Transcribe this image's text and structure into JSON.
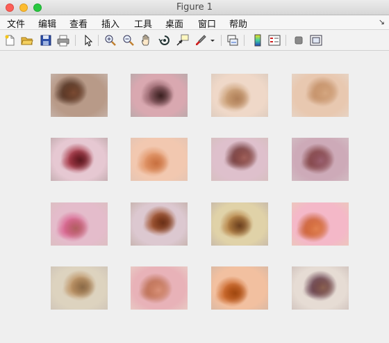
{
  "window": {
    "title": "Figure 1"
  },
  "menu": {
    "items": [
      "文件",
      "编辑",
      "查看",
      "插入",
      "工具",
      "桌面",
      "窗口",
      "帮助"
    ],
    "overflow_icon": "dock-arrow-icon"
  },
  "toolbar": {
    "buttons": [
      "new-figure-icon",
      "open-folder-icon",
      "save-icon",
      "print-icon",
      "pointer-icon",
      "zoom-in-icon",
      "zoom-out-icon",
      "pan-hand-icon",
      "rotate-3d-icon",
      "data-cursor-icon",
      "brush-icon",
      "brush-dropdown-icon",
      "link-plot-icon",
      "colorbar-icon",
      "legend-icon",
      "hide-plot-tools-icon",
      "show-plot-tools-icon"
    ]
  },
  "figure": {
    "grid_rows": 4,
    "grid_cols": 4,
    "images": [
      {
        "name": "dark-brown-lesion",
        "bg": "#b89a88",
        "spot": "#4a2a1a",
        "spot2": "#7a4a32"
      },
      {
        "name": "pink-speckled-lesion",
        "bg": "#d9a8b0",
        "spot": "#8a5860",
        "spot2": "#3a2020"
      },
      {
        "name": "tan-blotchy-lesion",
        "bg": "#efd8c8",
        "spot": "#c79a6e",
        "spot2": "#b0805a"
      },
      {
        "name": "light-brown-lesion",
        "bg": "#e8c8b0",
        "spot": "#c08a60",
        "spot2": "#d4a680"
      },
      {
        "name": "red-purple-lesion",
        "bg": "#e6c8d2",
        "spot": "#a02838",
        "spot2": "#5a1a20"
      },
      {
        "name": "peach-lesion",
        "bg": "#f2c8b0",
        "spot": "#e09060",
        "spot2": "#c87040"
      },
      {
        "name": "purple-brown-lesion",
        "bg": "#dec0cc",
        "spot": "#6a3030",
        "spot2": "#a0605a"
      },
      {
        "name": "mauve-lesion",
        "bg": "#cdaab8",
        "spot": "#7a3838",
        "spot2": "#9a6070"
      },
      {
        "name": "pink-spot-lesion",
        "bg": "#e4bccb",
        "spot": "#d85a8a",
        "spot2": "#b06060"
      },
      {
        "name": "brown-oval-lesion",
        "bg": "#dcc8d0",
        "spot": "#9a4820",
        "spot2": "#6a3018"
      },
      {
        "name": "beige-lesion",
        "bg": "#e0d2a8",
        "spot": "#b07838",
        "spot2": "#6a4020"
      },
      {
        "name": "orange-pink-lesion",
        "bg": "#f4b8c8",
        "spot": "#c85828",
        "spot2": "#e08050"
      },
      {
        "name": "pale-blotch-lesion",
        "bg": "#ddd3bf",
        "spot": "#b88a58",
        "spot2": "#8a6a48"
      },
      {
        "name": "pink-brown-lesion",
        "bg": "#e8b2b8",
        "spot": "#b86848",
        "spot2": "#d89078"
      },
      {
        "name": "orange-vignette-lesion",
        "bg": "#f2c0a0",
        "spot": "#c86020",
        "spot2": "#a04810"
      },
      {
        "name": "dark-small-lesion",
        "bg": "#e6dcd4",
        "spot": "#5a3040",
        "spot2": "#8a6050"
      }
    ]
  }
}
